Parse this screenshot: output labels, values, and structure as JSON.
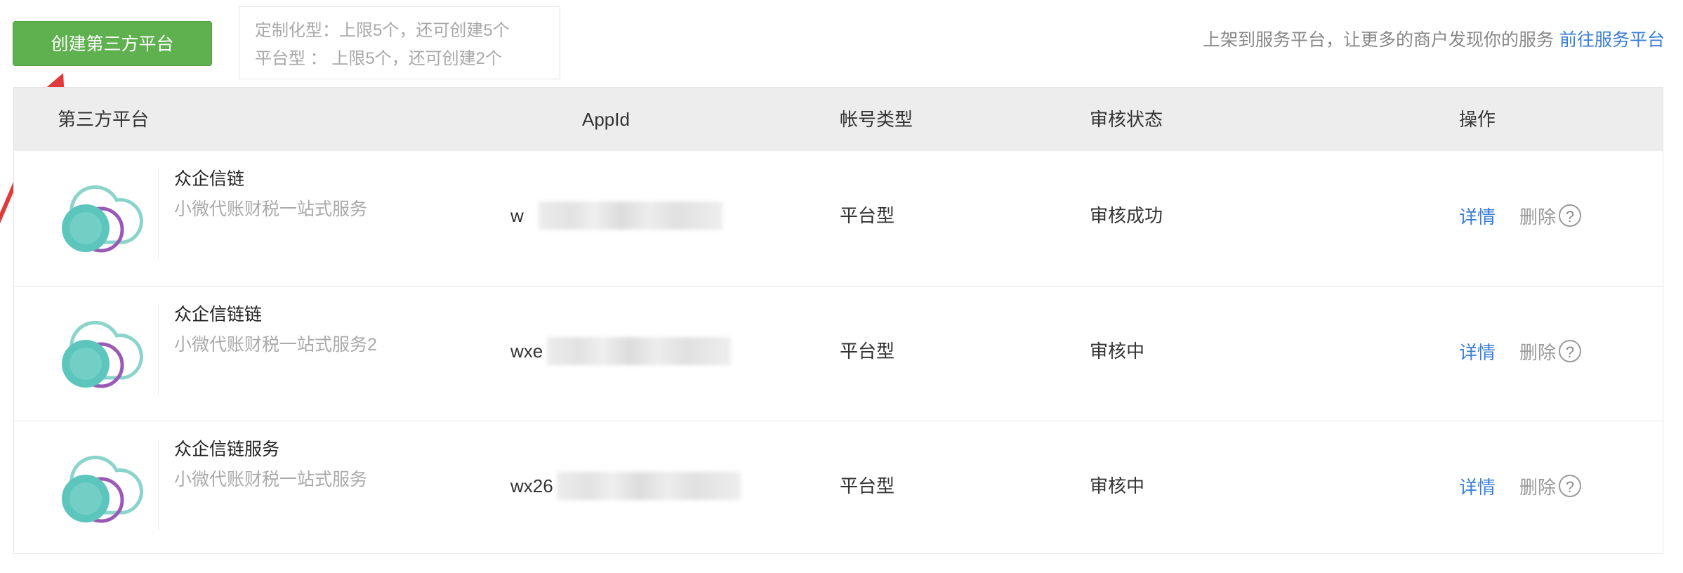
{
  "header": {
    "create_button_label": "创建第三方平台",
    "limit_customized": "定制化型：上限5个，还可创建5个",
    "limit_platform": "平台型 ： 上限5个，还可创建2个",
    "promo_text": "上架到服务平台，让更多的商户发现你的服务",
    "promo_link": "前往服务平台"
  },
  "table": {
    "columns": [
      "第三方平台",
      "AppId",
      "帐号类型",
      "审核状态",
      "操作"
    ],
    "rows": [
      {
        "name": "众企信链",
        "desc": "小微代账财税一站式服务",
        "appid_visible": "w",
        "type": "平台型",
        "status": "审核成功",
        "detail": "详情",
        "delete": "删除",
        "help": "?"
      },
      {
        "name": "众企信链链",
        "desc": "小微代账财税一站式服务2",
        "appid_visible": "wxe",
        "type": "平台型",
        "status": "审核中",
        "detail": "详情",
        "delete": "删除",
        "help": "?"
      },
      {
        "name": "众企信链服务",
        "desc": "小微代账财税一站式服务",
        "appid_visible": "wx26",
        "type": "平台型",
        "status": "审核中",
        "detail": "详情",
        "delete": "删除",
        "help": "?"
      }
    ]
  },
  "colors": {
    "primary_green": "#5fb14f",
    "link_blue": "#3a7fd5",
    "annotation_red": "#e03a3a",
    "logo_teal": "#5cc6bd",
    "logo_purple": "#9b59b6"
  },
  "icons": [
    "platform-logo-icon",
    "help-icon",
    "annotation-arrow"
  ]
}
